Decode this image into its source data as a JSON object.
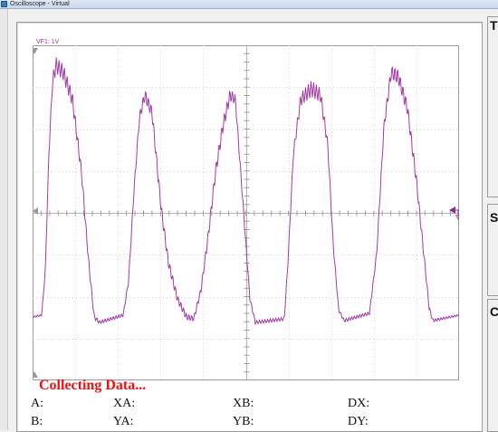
{
  "window": {
    "title": "Oscilloscope - Virtual"
  },
  "channel": {
    "label": "VF1: 1V",
    "trace_color": "#a23aa6"
  },
  "side_panels": {
    "top_letter": "T",
    "middle_letter": "S",
    "bottom_letter": "C"
  },
  "status": {
    "text": "Collecting Data...",
    "color": "#ee1111"
  },
  "readouts": {
    "a": "A:",
    "b": "B:",
    "xa": "XA:",
    "ya": "YA:",
    "xb": "XB:",
    "yb": "YB:",
    "dx": "DX:",
    "dy": "DY:"
  }
}
